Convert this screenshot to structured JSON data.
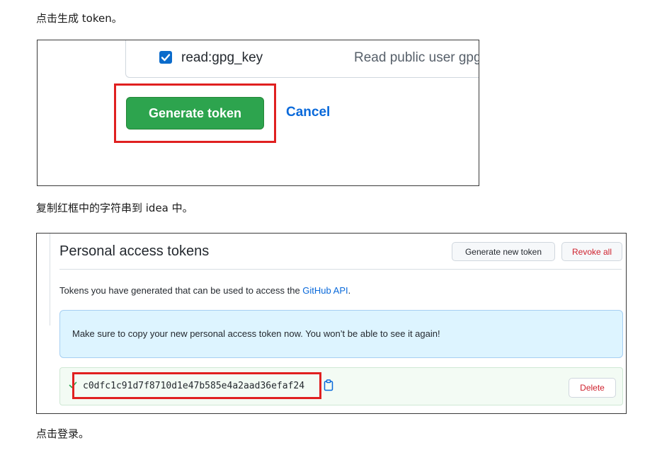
{
  "instructions": {
    "step1": "点击生成 token。",
    "step2": "复制红框中的字符串到 idea 中。",
    "step3": "点击登录。"
  },
  "screenshot1": {
    "scope": {
      "name": "read:gpg_key",
      "description": "Read public user gpg",
      "checked": true
    },
    "generate_button": "Generate token",
    "cancel_link": "Cancel",
    "highlight_color": "#e02020"
  },
  "screenshot2": {
    "title": "Personal access tokens",
    "generate_new_button": "Generate new token",
    "revoke_all_button": "Revoke all",
    "description_prefix": "Tokens you have generated that can be used to access the ",
    "description_link": "GitHub API",
    "description_suffix": ".",
    "flash_message": "Make sure to copy your new personal access token now. You won’t be able to see it again!",
    "token": "c0dfc1c91d7f8710d1e47b585e4a2aad36efaf24",
    "delete_button": "Delete",
    "icons": [
      "check-icon",
      "copy-icon"
    ]
  },
  "colors": {
    "primary_green": "#2da44e",
    "link_blue": "#0969da",
    "danger_red": "#cf222e",
    "highlight_red": "#e02020"
  }
}
